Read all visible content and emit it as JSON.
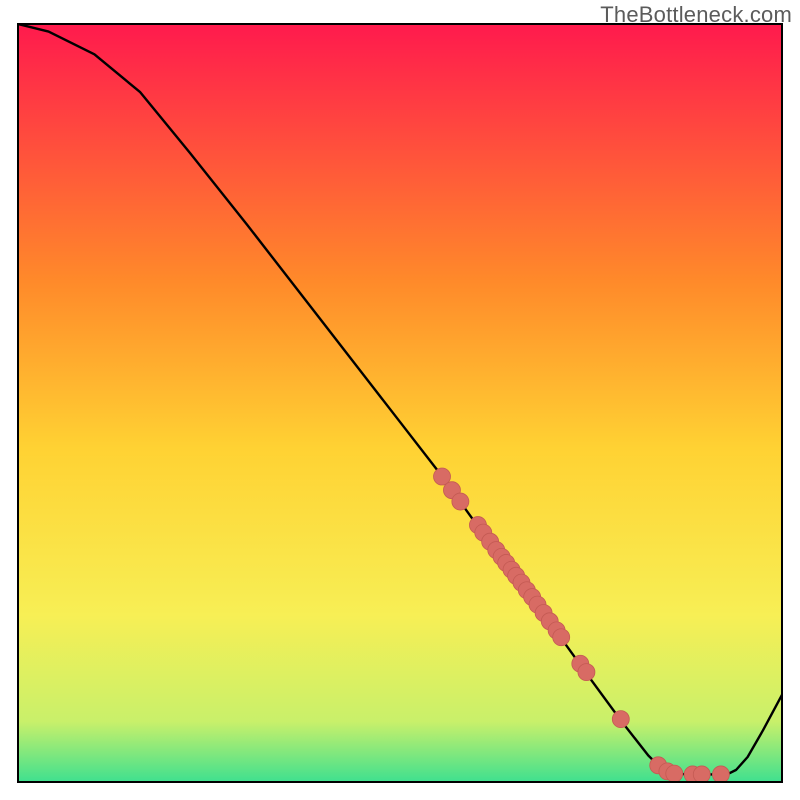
{
  "watermark": "TheBottleneck.com",
  "colors": {
    "curve": "#000000",
    "dot_fill": "#d86b64",
    "dot_stroke": "#c45a53",
    "border": "#000000",
    "grad_top": "#ff1a4d",
    "grad_mid_top": "#ff8a2a",
    "grad_mid": "#ffd233",
    "grad_mid_low": "#f7ef55",
    "grad_low": "#c9f06a",
    "grad_bottom": "#3fe08f"
  },
  "chart_data": {
    "type": "line",
    "title": "",
    "xlabel": "",
    "ylabel": "",
    "xlim": [
      0,
      100
    ],
    "ylim": [
      0,
      100
    ],
    "grid": false,
    "curve": [
      {
        "x": 0,
        "y": 100
      },
      {
        "x": 4,
        "y": 99
      },
      {
        "x": 10,
        "y": 96
      },
      {
        "x": 16,
        "y": 91
      },
      {
        "x": 22.5,
        "y": 83
      },
      {
        "x": 30,
        "y": 73.5
      },
      {
        "x": 40,
        "y": 60.5
      },
      {
        "x": 50,
        "y": 47.5
      },
      {
        "x": 55,
        "y": 41
      },
      {
        "x": 60,
        "y": 34
      },
      {
        "x": 65,
        "y": 27.5
      },
      {
        "x": 70,
        "y": 20.5
      },
      {
        "x": 75,
        "y": 13.5
      },
      {
        "x": 79,
        "y": 8
      },
      {
        "x": 82.5,
        "y": 3.5
      },
      {
        "x": 84,
        "y": 2
      },
      {
        "x": 85,
        "y": 1.4
      },
      {
        "x": 86,
        "y": 1.1
      },
      {
        "x": 88,
        "y": 1
      },
      {
        "x": 90,
        "y": 1
      },
      {
        "x": 92,
        "y": 1
      },
      {
        "x": 93,
        "y": 1.1
      },
      {
        "x": 94,
        "y": 1.6
      },
      {
        "x": 95.5,
        "y": 3.3
      },
      {
        "x": 97.5,
        "y": 6.8
      },
      {
        "x": 100,
        "y": 11.5
      }
    ],
    "series": [
      {
        "name": "points",
        "type": "scatter",
        "values": [
          {
            "x": 55.5,
            "y": 40.3
          },
          {
            "x": 56.8,
            "y": 38.5
          },
          {
            "x": 57.9,
            "y": 37.0
          },
          {
            "x": 60.2,
            "y": 33.9
          },
          {
            "x": 60.9,
            "y": 32.9
          },
          {
            "x": 61.8,
            "y": 31.7
          },
          {
            "x": 62.6,
            "y": 30.6
          },
          {
            "x": 63.3,
            "y": 29.7
          },
          {
            "x": 63.9,
            "y": 28.9
          },
          {
            "x": 64.6,
            "y": 28.0
          },
          {
            "x": 65.2,
            "y": 27.2
          },
          {
            "x": 65.9,
            "y": 26.3
          },
          {
            "x": 66.6,
            "y": 25.3
          },
          {
            "x": 67.3,
            "y": 24.4
          },
          {
            "x": 68.0,
            "y": 23.4
          },
          {
            "x": 68.8,
            "y": 22.3
          },
          {
            "x": 69.6,
            "y": 21.2
          },
          {
            "x": 70.5,
            "y": 20.0
          },
          {
            "x": 71.1,
            "y": 19.1
          },
          {
            "x": 73.6,
            "y": 15.6
          },
          {
            "x": 74.4,
            "y": 14.5
          },
          {
            "x": 78.9,
            "y": 8.3
          },
          {
            "x": 83.8,
            "y": 2.2
          },
          {
            "x": 85.0,
            "y": 1.4
          },
          {
            "x": 85.9,
            "y": 1.1
          },
          {
            "x": 88.3,
            "y": 1.0
          },
          {
            "x": 89.5,
            "y": 1.0
          },
          {
            "x": 92.0,
            "y": 1.0
          }
        ]
      }
    ]
  }
}
